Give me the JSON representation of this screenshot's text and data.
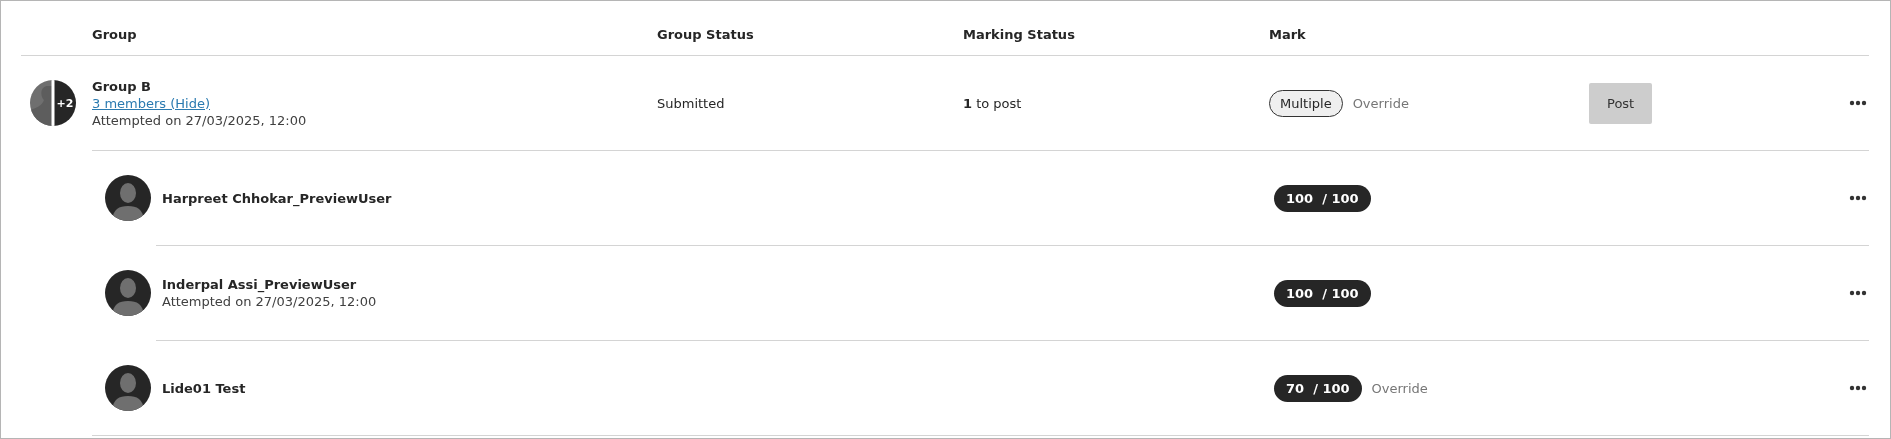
{
  "table": {
    "columns": [
      "Group",
      "Group Status",
      "Marking Status",
      "Mark"
    ],
    "group": {
      "name": "Group B",
      "extra_count": "+2",
      "members_link": "3 members (Hide)",
      "attempted": "Attempted on 27/03/2025, 12:00",
      "group_status": "Submitted",
      "marking_status": "**1** to post",
      "mark_button": "Multiple",
      "override": "Override",
      "post_button": {
        "label": "Post",
        "disabled": true
      }
    },
    "members": [
      {
        "name": "Harpreet Chhokar_PreviewUser",
        "score": "100",
        "total": "/ 100"
      },
      {
        "name": "Inderpal Assi_PreviewUser",
        "attempted": "Attempted on 27/03/2025, 12:00",
        "score": "100",
        "total": "/ 100"
      },
      {
        "name": "Lide01 Test",
        "score": "70",
        "total": "/ 100",
        "override": "Override"
      }
    ]
  }
}
